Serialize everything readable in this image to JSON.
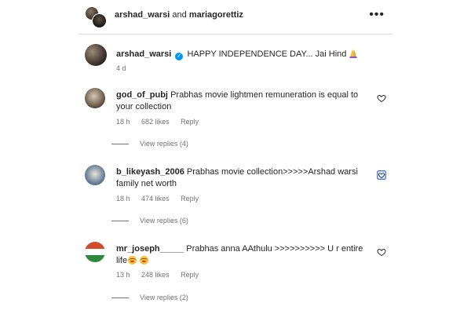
{
  "header": {
    "user1": "arshad_warsi",
    "joiner": "and",
    "user2": "mariagorettiz",
    "more_icon": "more-horizontal-icon"
  },
  "caption": {
    "username": "arshad_warsi",
    "text": "HAPPY INDEPENDENCE DAY... Jai Hind",
    "emoji": "folded-hands",
    "time": "4 d"
  },
  "comments": [
    {
      "username": "god_of_pubj",
      "text": "Prabhas movie lightmen remuneration is equal to your collection",
      "time": "18 h",
      "likes": "682 likes",
      "reply": "Reply",
      "view_replies": "View replies (4)"
    },
    {
      "username": "b_likeyash_2006",
      "text": "Prabhas movie collection>>>>>Arshad warsi family net worth",
      "time": "18 h",
      "likes": "474 likes",
      "reply": "Reply",
      "view_replies": "View replies (6)"
    },
    {
      "username": "mr_joseph_____",
      "text": "Prabhas anna AAthulu >>>>>>>>>> U r entire life",
      "emoji": "laughing-face x2",
      "time": "13 h",
      "likes": "248 likes",
      "reply": "Reply",
      "view_replies": "View replies (2)"
    }
  ],
  "colors": {
    "text": "#262626",
    "secondary": "#737373",
    "verified": "#0095f6",
    "divider": "#dbdbdb"
  }
}
